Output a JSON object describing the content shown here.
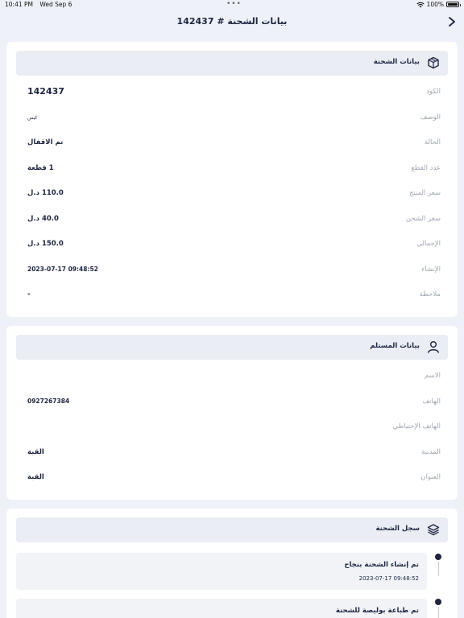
{
  "status_bar": {
    "time": "10:41 PM",
    "date": "Wed Sep 6",
    "battery": "100%"
  },
  "nav": {
    "title": "بيانات الشحنة # 142437"
  },
  "shipment": {
    "title": "بيانات الشحنة",
    "rows": [
      {
        "label": "الكود",
        "value": "142437"
      },
      {
        "label": "الوصف",
        "value": "كيس"
      },
      {
        "label": "الحالة",
        "value": "تم الاقفال"
      },
      {
        "label": "عدد القطع",
        "value": "1 قطعة"
      },
      {
        "label": "سعر المنتج",
        "value": "110.0 د.ل"
      },
      {
        "label": "سعر الشحن",
        "value": "40.0 د.ل"
      },
      {
        "label": "الإجمالي",
        "value": "150.0 د.ل"
      },
      {
        "label": "الإنشاء",
        "value": "2023-07-17 09:48:52"
      },
      {
        "label": "ملاحظة",
        "value": "-"
      }
    ]
  },
  "recipient": {
    "title": "بيانات المستلم",
    "rows": [
      {
        "label": "الاسم",
        "value": ""
      },
      {
        "label": "الهاتف",
        "value": "0927267384"
      },
      {
        "label": "الهاتف الإحتياطي",
        "value": ""
      },
      {
        "label": "المدينة",
        "value": "القبة"
      },
      {
        "label": "العنوان",
        "value": "القبة"
      }
    ]
  },
  "log": {
    "title": "سجل الشحنة",
    "items": [
      {
        "title": "تم إنشاء الشحنة بنجاح",
        "time": "2023-07-17 09:48:52"
      },
      {
        "title": "تم طباعة بوليصة للشحنة",
        "time": ""
      }
    ]
  },
  "colors": {
    "primary": "#1d2540",
    "background": "#eef1f7",
    "header_bg": "#eaedf4",
    "label": "#a1a6b4"
  }
}
